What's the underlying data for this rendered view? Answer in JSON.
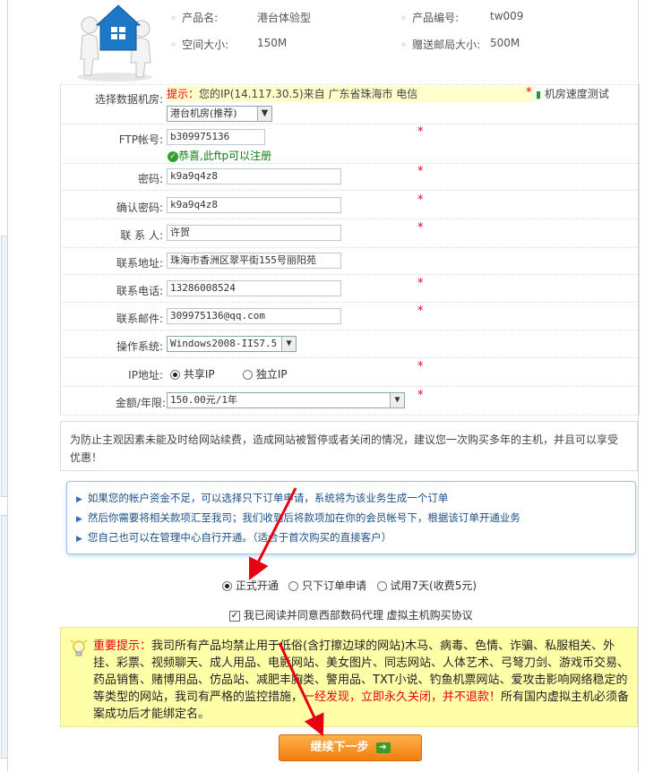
{
  "product": {
    "name_label": "产品名:",
    "name_value": "港台体验型",
    "code_label": "产品编号:",
    "code_value": "tw009",
    "space_label": "空间大小:",
    "space_value": "150M",
    "mail_label": "赠送邮局大小:",
    "mail_value": "500M"
  },
  "datacenter": {
    "label": "选择数据机房:",
    "tip_prefix": "提示：",
    "tip_text": "您的IP(14.117.30.5)来自 广东省珠海市 电信",
    "speed_test": "机房速度测试",
    "selected": "港台机房(推荐)"
  },
  "ftp": {
    "label": "FTP帐号:",
    "value": "b309975136",
    "ok_text": "恭喜,此ftp可以注册"
  },
  "password": {
    "label": "密码:",
    "value": "k9a9q4z8"
  },
  "confirm": {
    "label": "确认密码:",
    "value": "k9a9q4z8"
  },
  "contact": {
    "label": "联 系 人:",
    "value": "许贺"
  },
  "address": {
    "label": "联系地址:",
    "value": "珠海市香洲区翠平街155号丽阳苑"
  },
  "phone": {
    "label": "联系电话:",
    "value": "13286008524"
  },
  "email": {
    "label": "联系邮件:",
    "value": "309975136@qq.com"
  },
  "os": {
    "label": "操作系统:",
    "selected": "Windows2008-IIS7.5"
  },
  "ip": {
    "label": "IP地址:",
    "shared": "共享IP",
    "dedicated": "独立IP"
  },
  "price": {
    "label": "金额/年限:",
    "selected": "150.00元/1年"
  },
  "star": "*",
  "notice": "为防止主观因素未能及时给网站续费，造成网站被暂停或者关闭的情况，建议您一次购买多年的主机，并且可以享受优惠！",
  "info": {
    "items": [
      "如果您的帐户资金不足，可以选择只下订单申请，系统将为该业务生成一个订单",
      "然后你需要将相关款项汇至我司；我们收到后将款项加在你的会员帐号下，根据该订单开通业务",
      "您自己也可以在管理中心自行开通。（适合于首次购买的直接客户）"
    ]
  },
  "open_mode": {
    "formal": "正式开通",
    "order_only": "只下订单申请",
    "trial": "试用7天(收费5元)"
  },
  "agreement": "我已阅读并同意西部数码代理 虚拟主机购买协议",
  "warning": {
    "title": "重要提示：",
    "body1": "我司所有产品均禁止用于低俗(含打擦边球的网站)木马、病毒、色情、诈骗、私服相关、外挂、彩票、视频聊天、成人用品、电影网站、美女图片、同志网站、人体艺术、弓弩刀剑、游戏币交易、药品销售、赌博用品、仿品站、减肥丰胸类、警用品、TXT小说、钓鱼机票网站、爱攻击影响网络稳定的等类型的网站，我司有严格的监控措施，",
    "body_red": "一经发现，立即永久关闭，并不退款！",
    "body2": "所有国内虚拟主机必须备案成功后才能绑定名。"
  },
  "next_button": "继续下一步"
}
